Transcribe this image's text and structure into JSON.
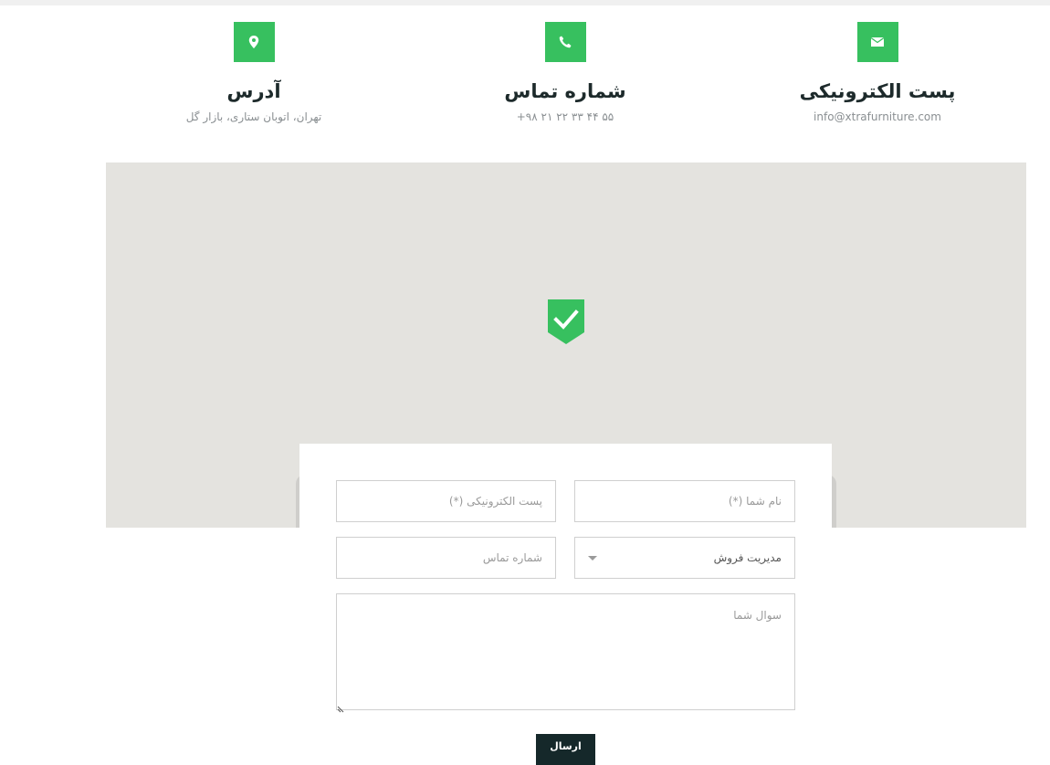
{
  "contact_info": {
    "email": {
      "icon": "envelope-icon",
      "title": "پست الکترونیکی",
      "value": "info@xtrafurniture.com"
    },
    "phone": {
      "icon": "phone-icon",
      "title": "شماره تماس",
      "value": "+۹۸ ۲۱ ۲۲ ۳۳ ۴۴ ۵۵"
    },
    "address": {
      "icon": "map-pin-icon",
      "title": "آدرس",
      "value": "تهران، اتوبان ستاری، بازار گل"
    }
  },
  "colors": {
    "accent": "#37c05f",
    "dark": "#15282a",
    "map_bg": "#e4e3df"
  },
  "map": {
    "marker_icon": "check-shield-icon"
  },
  "form": {
    "name_placeholder": "نام شما (*)",
    "email_placeholder": "پست الکترونیکی (*)",
    "department_selected": "مدیریت فروش",
    "phone_placeholder": "شماره تماس",
    "question_placeholder": "سوال شما",
    "submit_label": "ارسال"
  }
}
